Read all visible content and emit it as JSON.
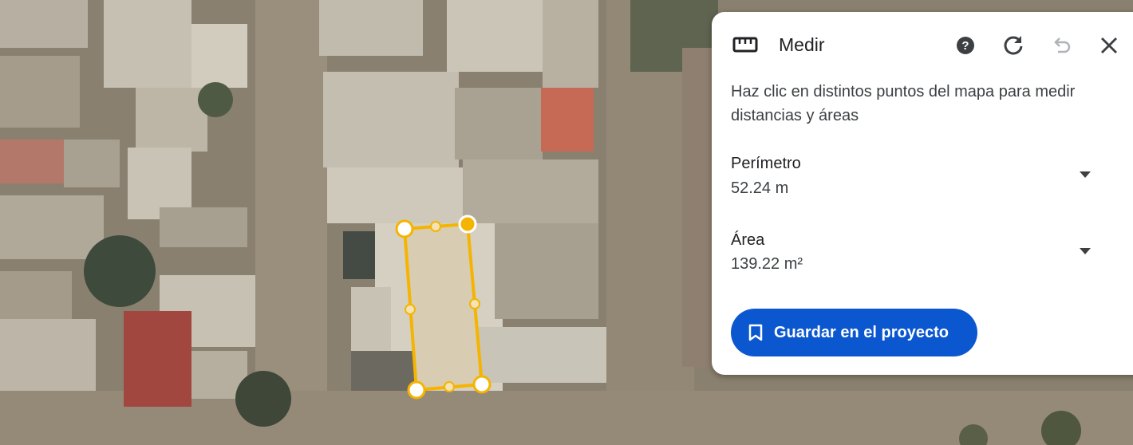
{
  "panel": {
    "title": "Medir",
    "description": "Haz clic en distintos puntos del mapa para medir distancias y áreas",
    "perimeter": {
      "label": "Perímetro",
      "value": "52.24 m"
    },
    "area": {
      "label": "Área",
      "value": "139.22 m²"
    },
    "save_button": "Guardar en el proyecto",
    "icons": {
      "ruler": "ruler-icon",
      "help": "help-icon",
      "reset": "refresh-icon",
      "undo": "undo-icon",
      "close": "close-icon",
      "dropdown": "chevron-down-icon",
      "bookmark": "bookmark-icon"
    }
  },
  "colors": {
    "accent": "#0b57d0",
    "measure_line": "#f5b400"
  }
}
